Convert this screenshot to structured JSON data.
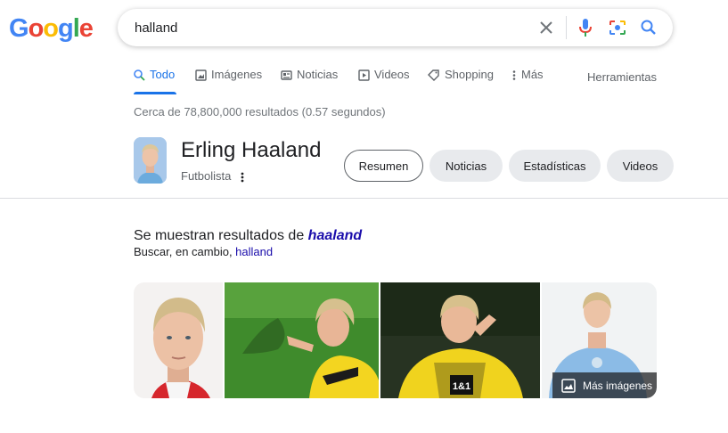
{
  "logo": {
    "letters": [
      "G",
      "o",
      "o",
      "g",
      "l",
      "e"
    ]
  },
  "search": {
    "query": "halland"
  },
  "tabs": [
    {
      "label": "Todo",
      "icon": "search-icon"
    },
    {
      "label": "Imágenes",
      "icon": "image-icon"
    },
    {
      "label": "Noticias",
      "icon": "news-icon"
    },
    {
      "label": "Videos",
      "icon": "video-icon"
    },
    {
      "label": "Shopping",
      "icon": "tag-icon"
    },
    {
      "label": "Más",
      "icon": "more-vert-icon"
    }
  ],
  "tools_label": "Herramientas",
  "result_stats": "Cerca de 78,800,000 resultados (0.57 segundos)",
  "knowledge_panel": {
    "title": "Erling Haaland",
    "subtitle": "Futbolista",
    "chips": [
      "Resumen",
      "Noticias",
      "Estadísticas",
      "Videos"
    ],
    "selected_chip": "Resumen"
  },
  "spelling": {
    "showing_prefix": "Se muestran resultados de ",
    "corrected": "haaland",
    "instead_prefix": "Buscar, en cambio, ",
    "original": "halland"
  },
  "images": {
    "more_label": "Más imágenes"
  },
  "colors": {
    "accent": "#1a73e8",
    "link": "#1a0dab",
    "chip_bg": "#e8eaed",
    "divider": "#dadce0"
  }
}
